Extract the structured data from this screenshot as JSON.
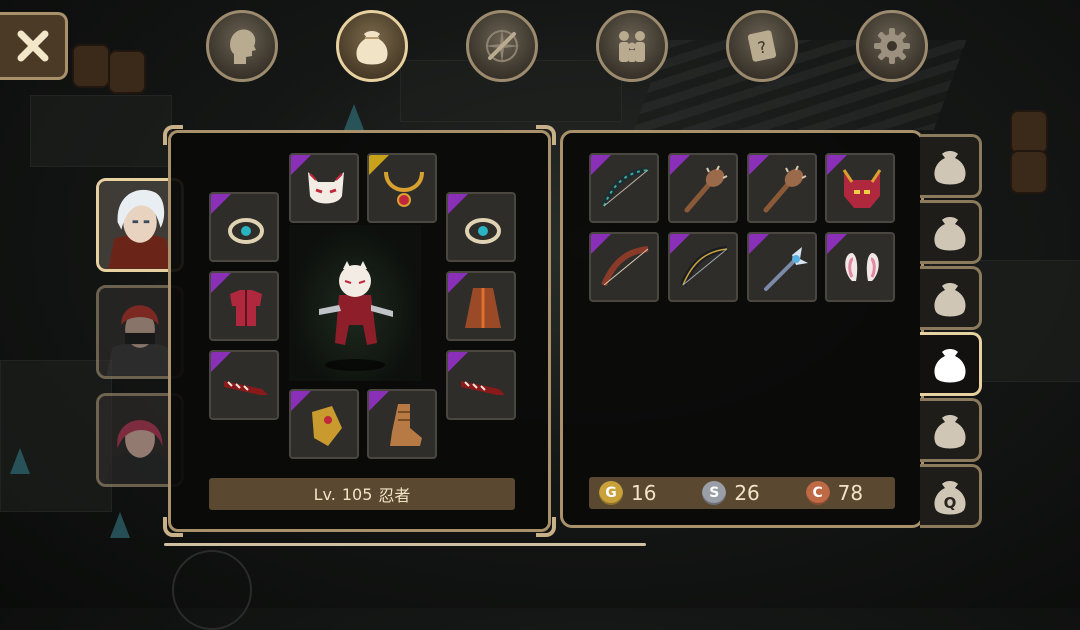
{
  "top_nav": {
    "close": "close-icon",
    "tabs": [
      {
        "id": "character",
        "icon": "head-icon",
        "active": false
      },
      {
        "id": "inventory",
        "icon": "bag-icon",
        "active": true
      },
      {
        "id": "skills",
        "icon": "compass-sword-icon",
        "active": false
      },
      {
        "id": "party",
        "icon": "people-icon",
        "active": false
      },
      {
        "id": "quests",
        "icon": "scroll-icon",
        "active": false
      },
      {
        "id": "settings",
        "icon": "gear-icon",
        "active": false
      }
    ]
  },
  "characters": [
    {
      "name": "white-hair-hero",
      "active": true
    },
    {
      "name": "red-hair-masked",
      "active": false
    },
    {
      "name": "pink-hair-girl",
      "active": false
    }
  ],
  "equipment": {
    "level_prefix": "Lv.",
    "level": "105",
    "class": "忍者",
    "slots": [
      {
        "name": "fox-mask",
        "icon": "fox-mask-icon",
        "rarity": "epic"
      },
      {
        "name": "gold-necklace",
        "icon": "necklace-icon",
        "rarity": "legendary"
      },
      {
        "name": "ring-left",
        "icon": "ring-icon",
        "rarity": "epic"
      },
      {
        "name": "ring-right",
        "icon": "ring-icon",
        "rarity": "epic"
      },
      {
        "name": "red-armor",
        "icon": "armor-icon",
        "rarity": "epic"
      },
      {
        "name": "brown-cloak",
        "icon": "cloak-icon",
        "rarity": "epic"
      },
      {
        "name": "blade-left",
        "icon": "blade-icon",
        "rarity": "epic"
      },
      {
        "name": "blade-right",
        "icon": "blade-icon",
        "rarity": "epic"
      },
      {
        "name": "gauntlet",
        "icon": "gauntlet-icon",
        "rarity": "epic"
      },
      {
        "name": "boots",
        "icon": "boot-icon",
        "rarity": "epic"
      }
    ]
  },
  "inventory": {
    "items": [
      {
        "name": "dark-bow",
        "icon": "bow-icon",
        "rarity": "epic"
      },
      {
        "name": "spiked-club",
        "icon": "club-icon",
        "rarity": "epic"
      },
      {
        "name": "spiked-club-2",
        "icon": "club-icon",
        "rarity": "epic"
      },
      {
        "name": "demon-helm",
        "icon": "demon-helm-icon",
        "rarity": "epic"
      },
      {
        "name": "red-bow",
        "icon": "bow-icon",
        "rarity": "epic"
      },
      {
        "name": "black-bow",
        "icon": "bow-icon",
        "rarity": "epic"
      },
      {
        "name": "winged-staff",
        "icon": "staff-icon",
        "rarity": "epic"
      },
      {
        "name": "bunny-ears",
        "icon": "bunny-ears-icon",
        "rarity": "epic"
      }
    ],
    "currency": {
      "gold": {
        "symbol": "G",
        "amount": "16",
        "color": "#c9a13a"
      },
      "silver": {
        "symbol": "S",
        "amount": "26",
        "color": "#9a9ea6"
      },
      "copper": {
        "symbol": "C",
        "amount": "78",
        "color": "#c06a45"
      }
    }
  },
  "bag_tabs": [
    {
      "icon": "bag-icon",
      "active": false
    },
    {
      "icon": "bag-icon",
      "active": false
    },
    {
      "icon": "bag-icon",
      "active": false
    },
    {
      "icon": "bag-icon",
      "active": true
    },
    {
      "icon": "bag-icon",
      "active": false
    },
    {
      "icon": "quest-bag-icon",
      "active": false
    }
  ],
  "colors": {
    "frame": "#a8916b",
    "panel": "#0a0a09",
    "epic": "#8a2fb8",
    "legendary": "#c9a21c",
    "bar": "#5a4830"
  }
}
